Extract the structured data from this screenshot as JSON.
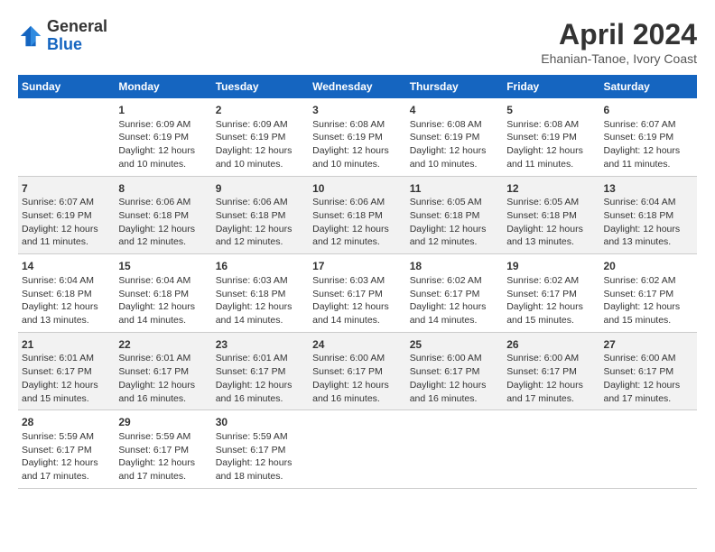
{
  "header": {
    "logo_line1": "General",
    "logo_line2": "Blue",
    "month": "April 2024",
    "location": "Ehanian-Tanoe, Ivory Coast"
  },
  "weekdays": [
    "Sunday",
    "Monday",
    "Tuesday",
    "Wednesday",
    "Thursday",
    "Friday",
    "Saturday"
  ],
  "weeks": [
    [
      {
        "day": "",
        "info": ""
      },
      {
        "day": "1",
        "info": "Sunrise: 6:09 AM\nSunset: 6:19 PM\nDaylight: 12 hours\nand 10 minutes."
      },
      {
        "day": "2",
        "info": "Sunrise: 6:09 AM\nSunset: 6:19 PM\nDaylight: 12 hours\nand 10 minutes."
      },
      {
        "day": "3",
        "info": "Sunrise: 6:08 AM\nSunset: 6:19 PM\nDaylight: 12 hours\nand 10 minutes."
      },
      {
        "day": "4",
        "info": "Sunrise: 6:08 AM\nSunset: 6:19 PM\nDaylight: 12 hours\nand 10 minutes."
      },
      {
        "day": "5",
        "info": "Sunrise: 6:08 AM\nSunset: 6:19 PM\nDaylight: 12 hours\nand 11 minutes."
      },
      {
        "day": "6",
        "info": "Sunrise: 6:07 AM\nSunset: 6:19 PM\nDaylight: 12 hours\nand 11 minutes."
      }
    ],
    [
      {
        "day": "7",
        "info": "Sunrise: 6:07 AM\nSunset: 6:19 PM\nDaylight: 12 hours\nand 11 minutes."
      },
      {
        "day": "8",
        "info": "Sunrise: 6:06 AM\nSunset: 6:18 PM\nDaylight: 12 hours\nand 12 minutes."
      },
      {
        "day": "9",
        "info": "Sunrise: 6:06 AM\nSunset: 6:18 PM\nDaylight: 12 hours\nand 12 minutes."
      },
      {
        "day": "10",
        "info": "Sunrise: 6:06 AM\nSunset: 6:18 PM\nDaylight: 12 hours\nand 12 minutes."
      },
      {
        "day": "11",
        "info": "Sunrise: 6:05 AM\nSunset: 6:18 PM\nDaylight: 12 hours\nand 12 minutes."
      },
      {
        "day": "12",
        "info": "Sunrise: 6:05 AM\nSunset: 6:18 PM\nDaylight: 12 hours\nand 13 minutes."
      },
      {
        "day": "13",
        "info": "Sunrise: 6:04 AM\nSunset: 6:18 PM\nDaylight: 12 hours\nand 13 minutes."
      }
    ],
    [
      {
        "day": "14",
        "info": "Sunrise: 6:04 AM\nSunset: 6:18 PM\nDaylight: 12 hours\nand 13 minutes."
      },
      {
        "day": "15",
        "info": "Sunrise: 6:04 AM\nSunset: 6:18 PM\nDaylight: 12 hours\nand 14 minutes."
      },
      {
        "day": "16",
        "info": "Sunrise: 6:03 AM\nSunset: 6:18 PM\nDaylight: 12 hours\nand 14 minutes."
      },
      {
        "day": "17",
        "info": "Sunrise: 6:03 AM\nSunset: 6:17 PM\nDaylight: 12 hours\nand 14 minutes."
      },
      {
        "day": "18",
        "info": "Sunrise: 6:02 AM\nSunset: 6:17 PM\nDaylight: 12 hours\nand 14 minutes."
      },
      {
        "day": "19",
        "info": "Sunrise: 6:02 AM\nSunset: 6:17 PM\nDaylight: 12 hours\nand 15 minutes."
      },
      {
        "day": "20",
        "info": "Sunrise: 6:02 AM\nSunset: 6:17 PM\nDaylight: 12 hours\nand 15 minutes."
      }
    ],
    [
      {
        "day": "21",
        "info": "Sunrise: 6:01 AM\nSunset: 6:17 PM\nDaylight: 12 hours\nand 15 minutes."
      },
      {
        "day": "22",
        "info": "Sunrise: 6:01 AM\nSunset: 6:17 PM\nDaylight: 12 hours\nand 16 minutes."
      },
      {
        "day": "23",
        "info": "Sunrise: 6:01 AM\nSunset: 6:17 PM\nDaylight: 12 hours\nand 16 minutes."
      },
      {
        "day": "24",
        "info": "Sunrise: 6:00 AM\nSunset: 6:17 PM\nDaylight: 12 hours\nand 16 minutes."
      },
      {
        "day": "25",
        "info": "Sunrise: 6:00 AM\nSunset: 6:17 PM\nDaylight: 12 hours\nand 16 minutes."
      },
      {
        "day": "26",
        "info": "Sunrise: 6:00 AM\nSunset: 6:17 PM\nDaylight: 12 hours\nand 17 minutes."
      },
      {
        "day": "27",
        "info": "Sunrise: 6:00 AM\nSunset: 6:17 PM\nDaylight: 12 hours\nand 17 minutes."
      }
    ],
    [
      {
        "day": "28",
        "info": "Sunrise: 5:59 AM\nSunset: 6:17 PM\nDaylight: 12 hours\nand 17 minutes."
      },
      {
        "day": "29",
        "info": "Sunrise: 5:59 AM\nSunset: 6:17 PM\nDaylight: 12 hours\nand 17 minutes."
      },
      {
        "day": "30",
        "info": "Sunrise: 5:59 AM\nSunset: 6:17 PM\nDaylight: 12 hours\nand 18 minutes."
      },
      {
        "day": "",
        "info": ""
      },
      {
        "day": "",
        "info": ""
      },
      {
        "day": "",
        "info": ""
      },
      {
        "day": "",
        "info": ""
      }
    ]
  ]
}
